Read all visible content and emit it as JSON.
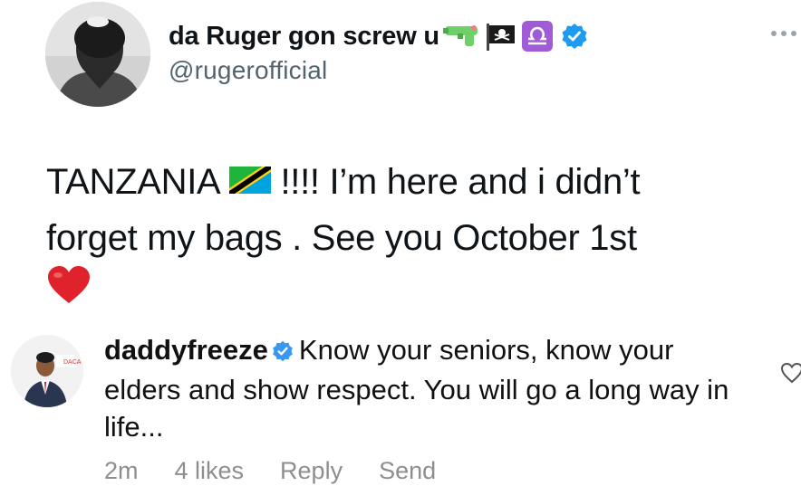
{
  "tweet": {
    "display_name": "da Ruger gon screw u",
    "handle": "@rugerofficial",
    "name_emojis": [
      "water-pistol-emoji",
      "pirate-flag-emoji",
      "libra-emoji"
    ],
    "verified": true,
    "more_icon": "more-dots-icon",
    "text_lines": [
      "TANZANIA",
      "!!!! I’m here and i didn’t",
      "forget my bags . See you October 1st"
    ],
    "inline_emojis": [
      "tanzania-flag-emoji",
      "red-heart-emoji"
    ]
  },
  "comment": {
    "username": "daddyfreeze",
    "verified": true,
    "text": "Know your seniors, know your elders and show respect. You will go a long way in life...",
    "time": "2m",
    "likes": "4 likes",
    "reply_label": "Reply",
    "send_label": "Send",
    "avatar_badge_text": "DACA"
  },
  "colors": {
    "verified_blue": "#1d9bf0",
    "heart_red": "#e0222d",
    "muted_gray": "#8e8e8e",
    "handle_gray": "#536471"
  }
}
